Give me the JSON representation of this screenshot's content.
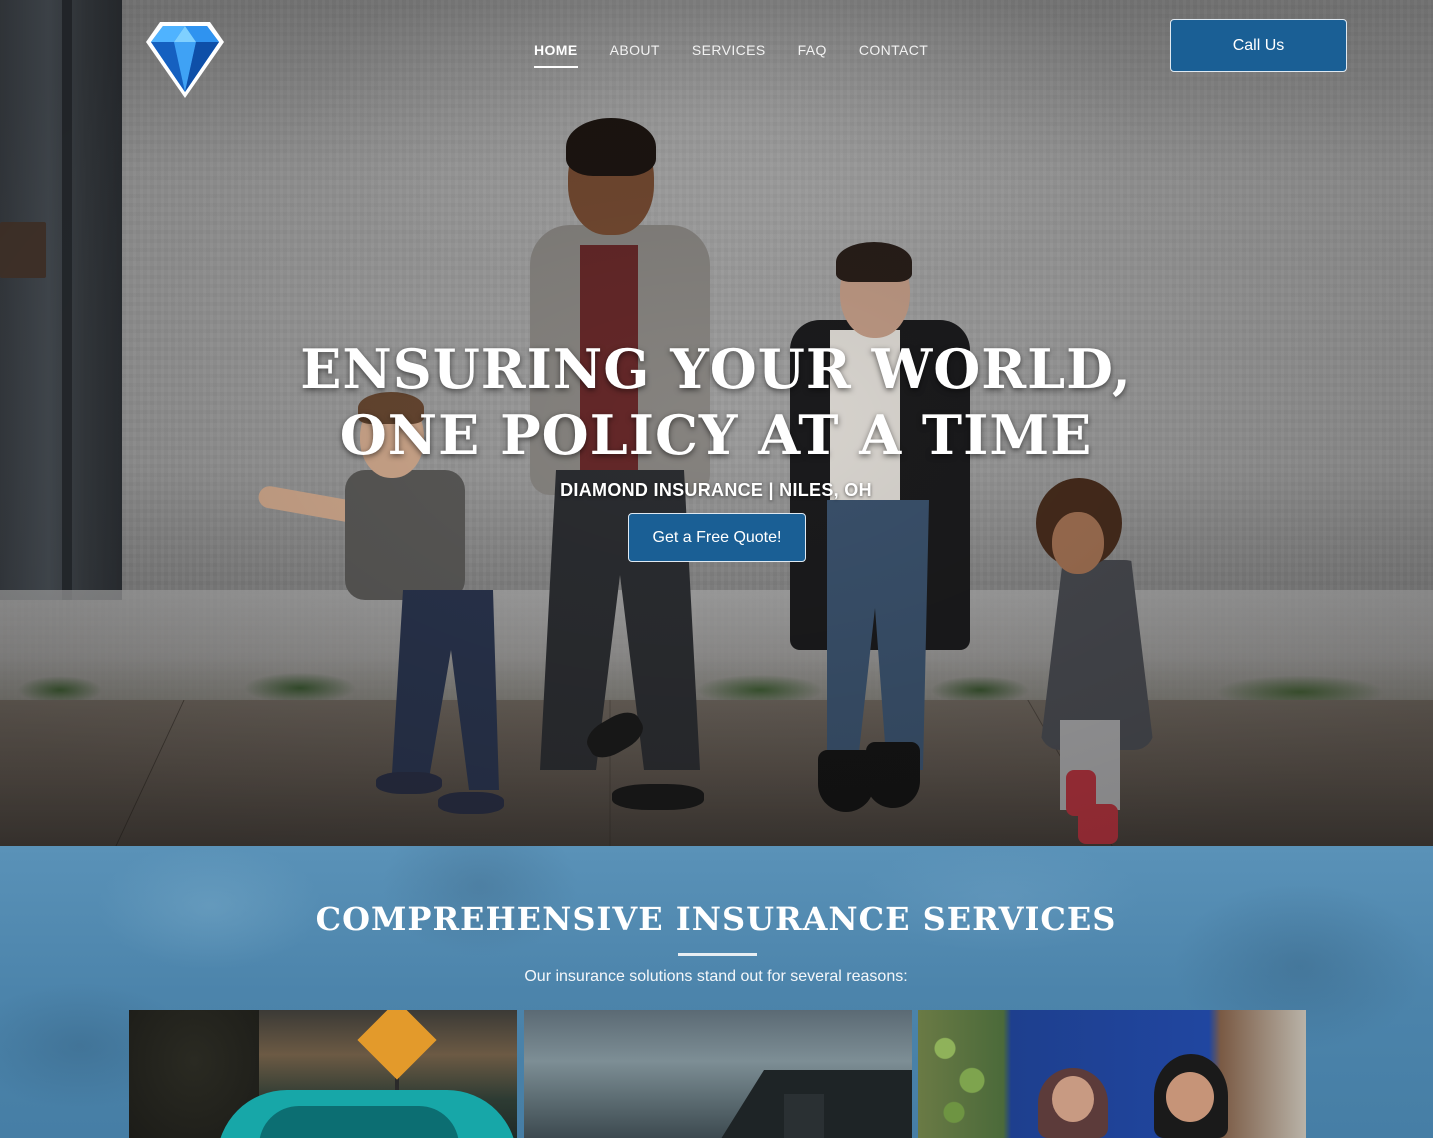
{
  "header": {
    "logo_icon": "diamond-gem-icon",
    "nav": [
      {
        "label": "HOME",
        "active": true
      },
      {
        "label": "ABOUT",
        "active": false
      },
      {
        "label": "SERVICES",
        "active": false
      },
      {
        "label": "FAQ",
        "active": false
      },
      {
        "label": "CONTACT",
        "active": false
      }
    ],
    "call_button": "Call Us"
  },
  "hero": {
    "headline_line1": "ENSURING YOUR WORLD,",
    "headline_line2": "ONE POLICY AT A TIME",
    "subheadline": "DIAMOND INSURANCE | NILES, OH",
    "cta_button": "Get a Free Quote!"
  },
  "services": {
    "title": "COMPREHENSIVE INSURANCE SERVICES",
    "subtitle": "Our insurance solutions stand out for several reasons:",
    "cards": [
      {
        "image": "car-under-road-sign-photo"
      },
      {
        "image": "house-roof-at-dusk-photo"
      },
      {
        "image": "elderly-couple-smiling-photo"
      }
    ]
  },
  "colors": {
    "primary_button": "#1a5f95",
    "services_background": "#4c84ab",
    "text": "#ffffff"
  }
}
